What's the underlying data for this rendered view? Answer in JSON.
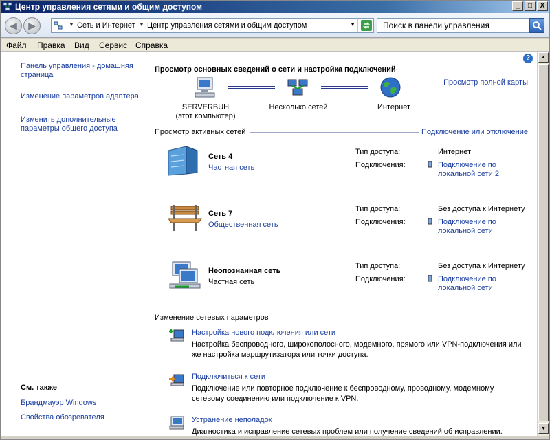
{
  "window": {
    "title": "Центр управления сетями и общим доступом",
    "buttons": [
      "_",
      "□",
      "X"
    ]
  },
  "navigation": {
    "back_icon": "back-arrow-icon",
    "forward_icon": "forward-arrow-icon",
    "breadcrumb": [
      "Сеть и Интернет",
      "Центр управления сетями и общим доступом"
    ],
    "search_placeholder": "Поиск в панели управления"
  },
  "menu": [
    "Файл",
    "Правка",
    "Вид",
    "Сервис",
    "Справка"
  ],
  "sidebar": {
    "items": [
      "Панель управления - домашняя страница",
      "Изменение параметров адаптера",
      "Изменить дополнительные параметры общего доступа"
    ],
    "see_also_title": "См. также",
    "see_also": [
      "Брандмауэр Windows",
      "Свойства обозревателя"
    ]
  },
  "main": {
    "heading": "Просмотр основных сведений о сети и настройка подключений",
    "full_map_link": "Просмотр полной карты",
    "map": {
      "computer_name": "SERVERBUH",
      "computer_sub": "(этот компьютер)",
      "middle": "Несколько сетей",
      "internet": "Интернет"
    },
    "active_section": "Просмотр активных сетей",
    "connect_link": "Подключение или отключение",
    "access_label": "Тип доступа:",
    "conn_label": "Подключения:",
    "networks": [
      {
        "name": "Сеть  4",
        "type": "Частная сеть",
        "type_is_link": true,
        "access": "Интернет",
        "connection": "Подключение по локальной сети 2",
        "icon": "office-building-icon"
      },
      {
        "name": "Сеть  7",
        "type": "Общественная сеть",
        "type_is_link": true,
        "access": "Без доступа к Интернету",
        "connection": "Подключение по локальной сети",
        "icon": "park-bench-icon"
      },
      {
        "name": "Неопознанная сеть",
        "type": "Частная сеть",
        "type_is_link": false,
        "access": "Без доступа к Интернету",
        "connection": "Подключение по локальной сети",
        "icon": "network-computers-icon"
      }
    ],
    "change_section": "Изменение сетевых параметров",
    "tasks": [
      {
        "title": "Настройка нового подключения или сети",
        "desc": "Настройка беспроводного, широкополосного, модемного, прямого или VPN-подключения или же настройка маршрутизатора или точки доступа."
      },
      {
        "title": "Подключиться к сети",
        "desc": "Подключение или повторное подключение к беспроводному, проводному, модемному сетевому соединению или подключение к VPN."
      },
      {
        "title": "Устранение неполадок",
        "desc": "Диагностика и исправление сетевых проблем или получение сведений об исправлении."
      }
    ]
  },
  "colors": {
    "link": "#1c3fa0",
    "titlebar": "#0a246a"
  }
}
